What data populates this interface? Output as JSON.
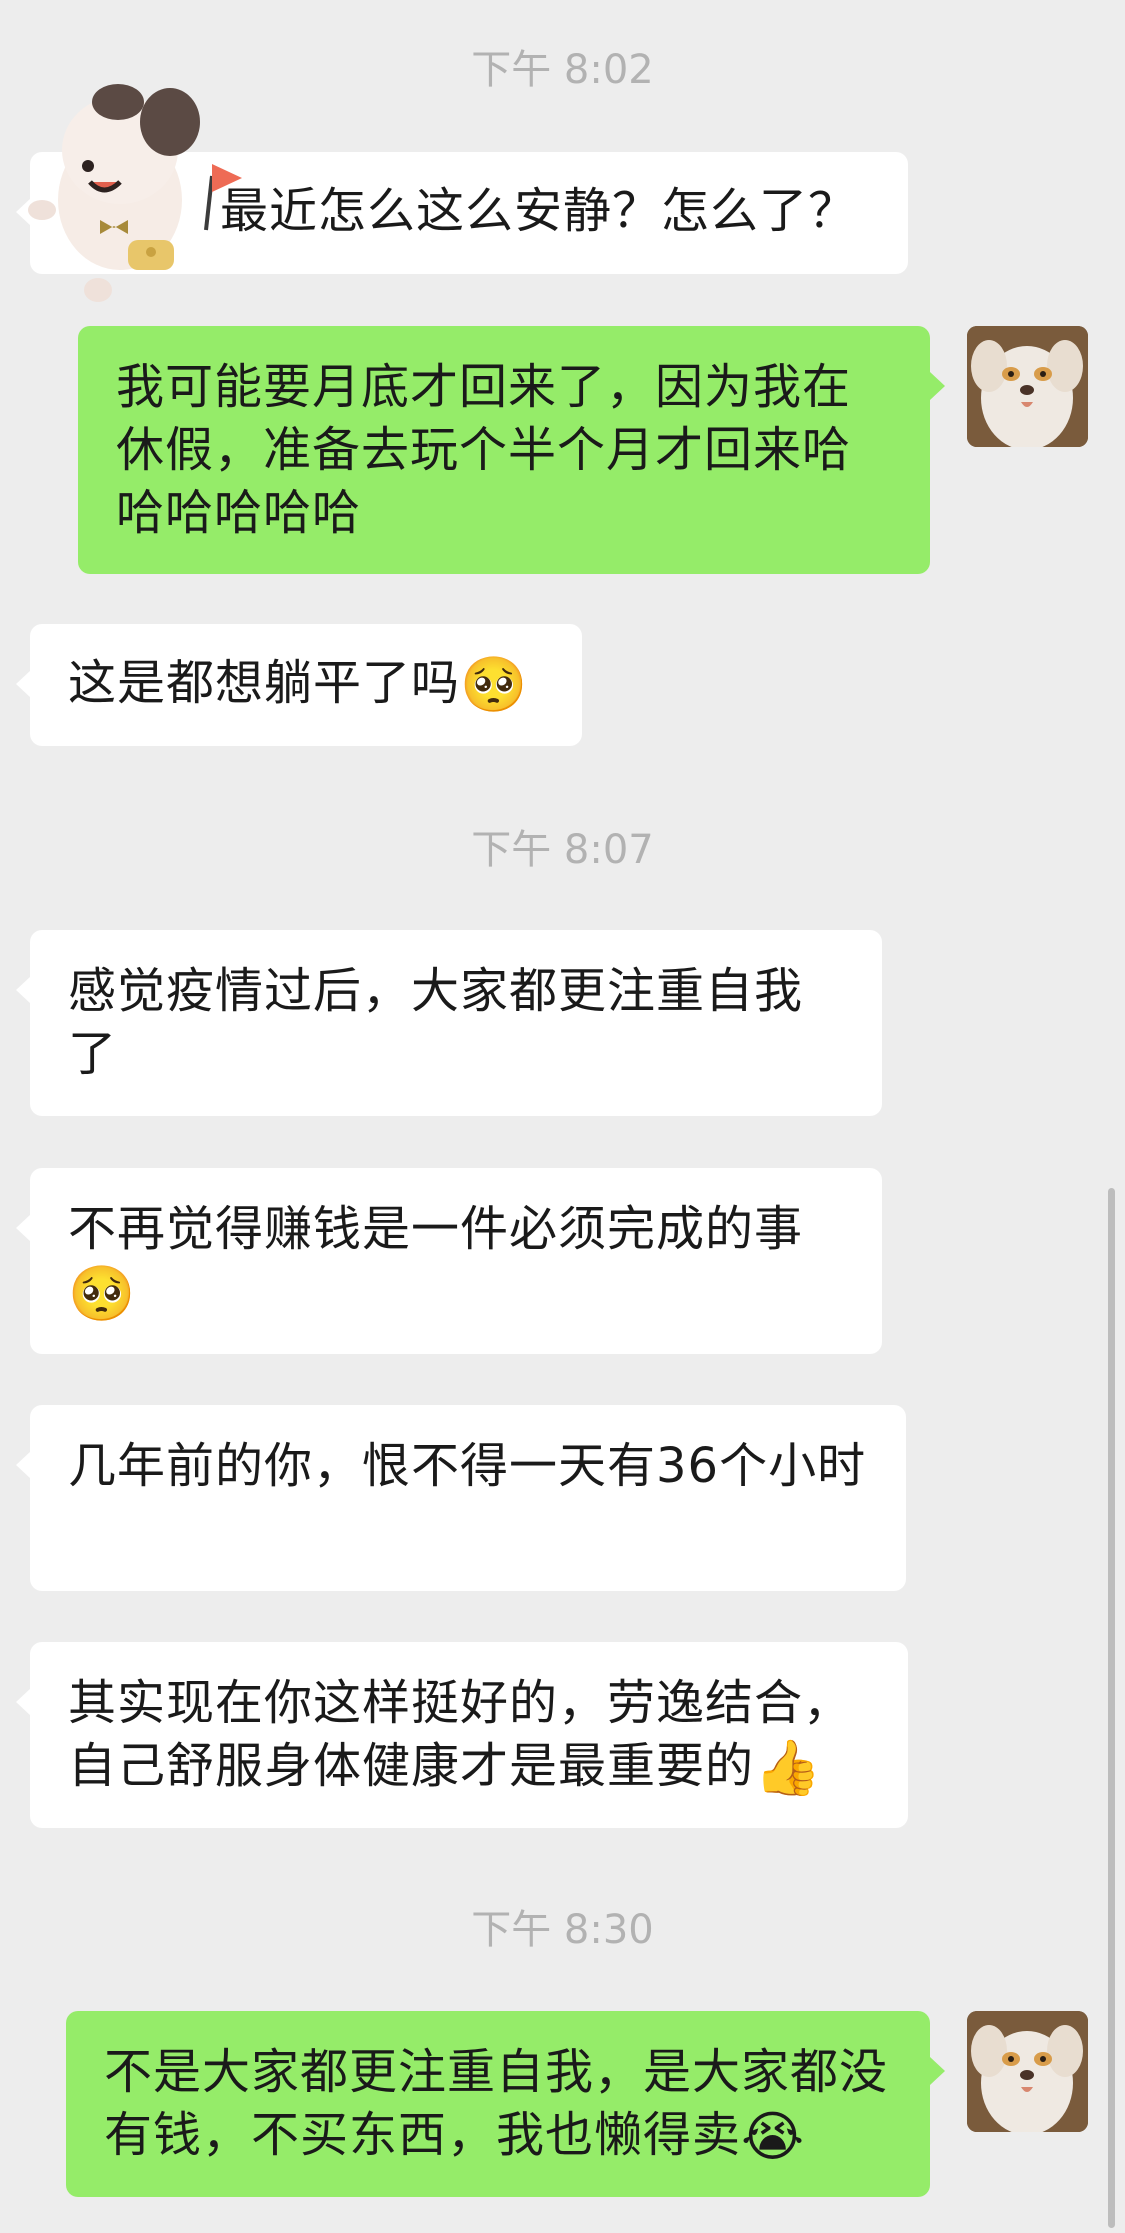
{
  "times": [
    "下午 8:02",
    "下午 8:07",
    "下午 8:30"
  ],
  "messages": [
    {
      "text": "最近怎么这么安静？怎么了？"
    },
    {
      "text": "我可能要月底才回来了，因为我在休假，准备去玩个半个月才回来哈哈哈哈哈哈"
    },
    {
      "text": "这是都想躺平了吗",
      "emoji": "🥺"
    },
    {
      "text": "感觉疫情过后，大家都更注重自我了"
    },
    {
      "text": "不再觉得赚钱是一件必须完成的事",
      "emoji": "🥺"
    },
    {
      "text": "几年前的你，恨不得一天有36个小时"
    },
    {
      "text": "其实现在你这样挺好的，劳逸结合，自己舒服身体健康才是最重要的",
      "emoji": "👍"
    },
    {
      "text": "不是大家都更注重自我，是大家都没有钱，不买东西，我也懒得卖",
      "emoji": "😭"
    }
  ],
  "icons": {
    "sticker": "cartoon-dog-sticker",
    "avatar": "dog-avatar"
  },
  "colors": {
    "background": "#ededed",
    "incoming_bubble": "#ffffff",
    "outgoing_bubble": "#95ec69",
    "timestamp": "#b2b2b2"
  }
}
